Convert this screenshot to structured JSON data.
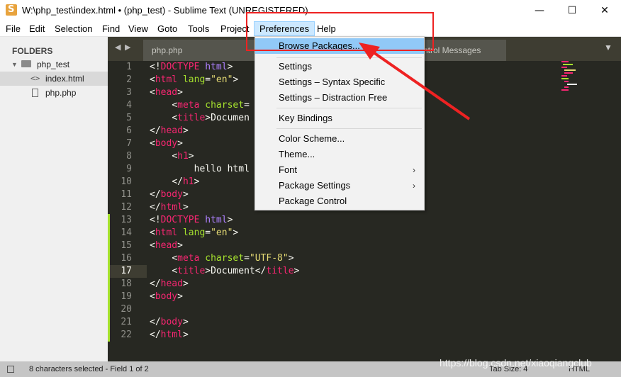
{
  "window": {
    "title": "W:\\php_test\\index.html • (php_test) - Sublime Text (UNREGISTERED)",
    "min_glyph": "—",
    "max_glyph": "☐",
    "close_glyph": "✕"
  },
  "menubar": [
    "File",
    "Edit",
    "Selection",
    "Find",
    "View",
    "Goto",
    "Tools",
    "Project",
    "Preferences",
    "Help"
  ],
  "sidebar": {
    "header": "FOLDERS",
    "folder": "php_test",
    "files": [
      "index.html",
      "php.php"
    ]
  },
  "tabs": [
    "php.php",
    "ntrol Messages"
  ],
  "preferences_menu": {
    "items": [
      "Browse Packages...",
      "Settings",
      "Settings – Syntax Specific",
      "Settings – Distraction Free",
      "Key Bindings",
      "Color Scheme...",
      "Theme...",
      "Font",
      "Package Settings",
      "Package Control"
    ],
    "submenu_chevron": "›"
  },
  "editor": {
    "line_numbers": [
      "1",
      "2",
      "3",
      "4",
      "5",
      "6",
      "7",
      "8",
      "9",
      "10",
      "11",
      "12",
      "13",
      "14",
      "15",
      "16",
      "17",
      "18",
      "19",
      "20",
      "21",
      "22"
    ],
    "lines": [
      "<!DOCTYPE html>",
      "<html lang=\"en\">",
      "<head>",
      "    <meta charset=",
      "    <title>Documen",
      "</head>",
      "<body>",
      "    <h1>",
      "        hello html",
      "    </h1>",
      "</body>",
      "</html>",
      "<!DOCTYPE html>",
      "<html lang=\"en\">",
      "<head>",
      "    <meta charset=\"UTF-8\">",
      "    <title>Document</title>",
      "</head>",
      "<body>",
      "",
      "</body>",
      "</html>"
    ]
  },
  "statusbar": {
    "left": "8 characters selected - Field 1 of 2",
    "tab_size": "Tab Size: 4",
    "syntax": "HTML"
  },
  "watermark": "https://blog.csdn.net/xiaoqiangclub",
  "colors": {
    "tag": "#f92672",
    "attr": "#a6e22e",
    "string": "#e6db74",
    "highlight": "#91c9f7",
    "annotation": "#ee2222"
  }
}
